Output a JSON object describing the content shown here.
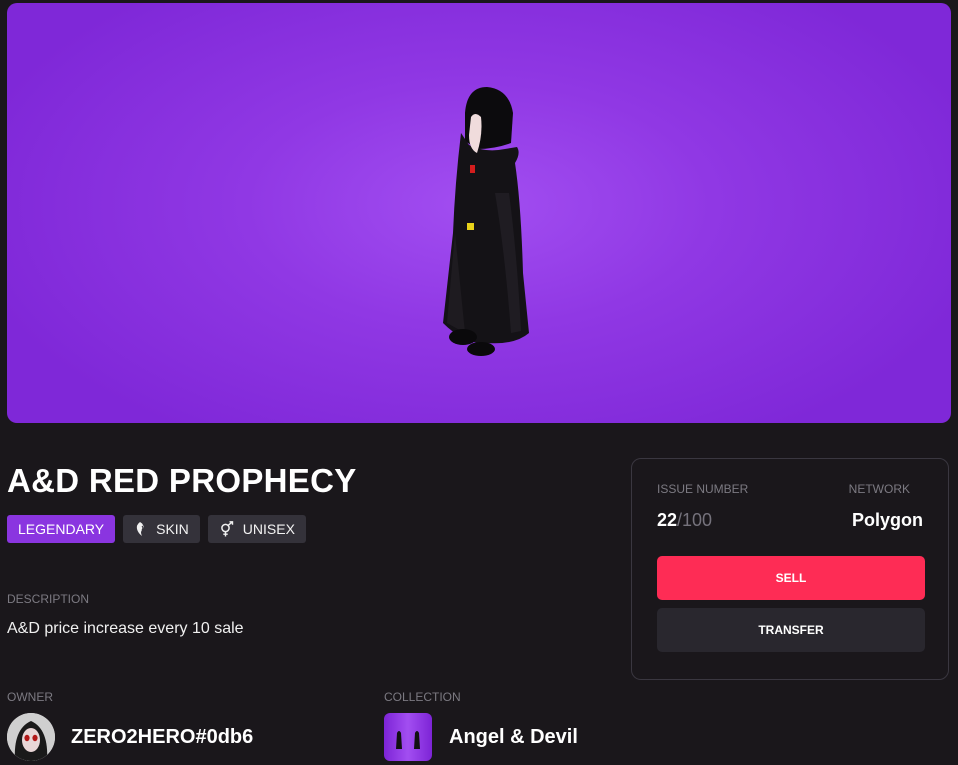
{
  "item": {
    "title": "A&D RED PROPHECY",
    "tags": [
      {
        "label": "LEGENDARY",
        "icon": null
      },
      {
        "label": "SKIN",
        "icon": "skin-icon"
      },
      {
        "label": "UNISEX",
        "icon": "unisex-icon"
      }
    ],
    "description_label": "DESCRIPTION",
    "description": "A&D price increase every 10 sale"
  },
  "panel": {
    "issue_label": "ISSUE NUMBER",
    "issue_number": "22",
    "issue_total": "/100",
    "network_label": "NETWORK",
    "network": "Polygon",
    "sell_label": "SELL",
    "transfer_label": "TRANSFER"
  },
  "owner": {
    "label": "OWNER",
    "name": "ZERO2HERO#0db6"
  },
  "collection": {
    "label": "COLLECTION",
    "name": "Angel & Devil"
  },
  "colors": {
    "background": "#1a171b",
    "hero_purple": "#9038e4",
    "rarity_legendary": "#8a35e0",
    "sell_button": "#fe2c55"
  }
}
